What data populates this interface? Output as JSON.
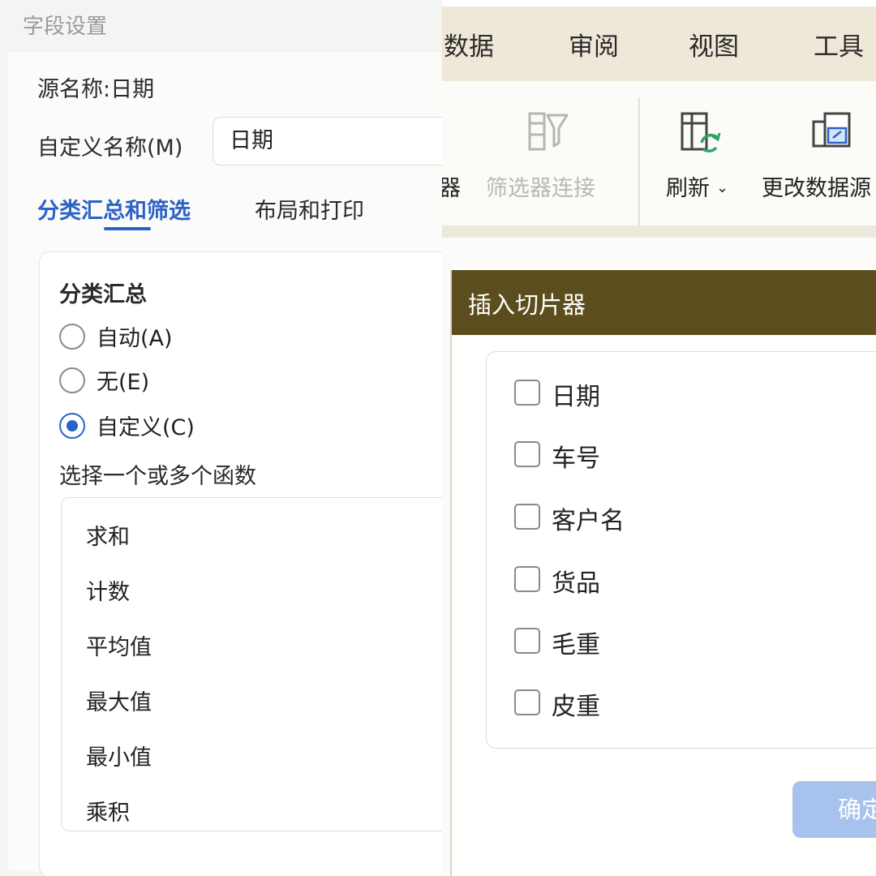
{
  "field_settings": {
    "window_title": "字段设置",
    "source_name": "源名称:日期",
    "custom_name_label": "自定义名称(M)",
    "custom_name_value": "日期",
    "tabs": [
      {
        "label": "分类汇总和筛选",
        "active": true
      },
      {
        "label": "布局和打印",
        "active": false
      }
    ],
    "subtotal_section_title": "分类汇总",
    "subtotal_options": [
      {
        "label": "自动(A)",
        "checked": false
      },
      {
        "label": "无(E)",
        "checked": false
      },
      {
        "label": "自定义(C)",
        "checked": true
      }
    ],
    "functions_title": "选择一个或多个函数",
    "functions": [
      "求和",
      "计数",
      "平均值",
      "最大值",
      "最小值",
      "乘积"
    ]
  },
  "ribbon": {
    "menu": [
      "数据",
      "审阅",
      "视图",
      "工具"
    ],
    "tools": [
      {
        "label": "器",
        "icon": "slicer-icon"
      },
      {
        "label": "筛选器连接",
        "icon": "filter-connection-icon",
        "disabled": true
      },
      {
        "label": "刷新",
        "icon": "refresh-icon",
        "has_dropdown": true
      },
      {
        "label": "更改数据源",
        "icon": "change-data-source-icon"
      }
    ]
  },
  "slicer_dialog": {
    "title": "插入切片器",
    "fields": [
      {
        "label": "日期",
        "checked": false
      },
      {
        "label": "车号",
        "checked": false
      },
      {
        "label": "客户名",
        "checked": false
      },
      {
        "label": "货品",
        "checked": false
      },
      {
        "label": "毛重",
        "checked": false
      },
      {
        "label": "皮重",
        "checked": false
      }
    ],
    "ok_label": "确定"
  },
  "colors": {
    "accent_blue": "#2c62c8",
    "dialog_title_bar": "#5b4d1d",
    "ok_button_disabled": "#a7c2ec",
    "refresh_green": "#2fa36b"
  }
}
